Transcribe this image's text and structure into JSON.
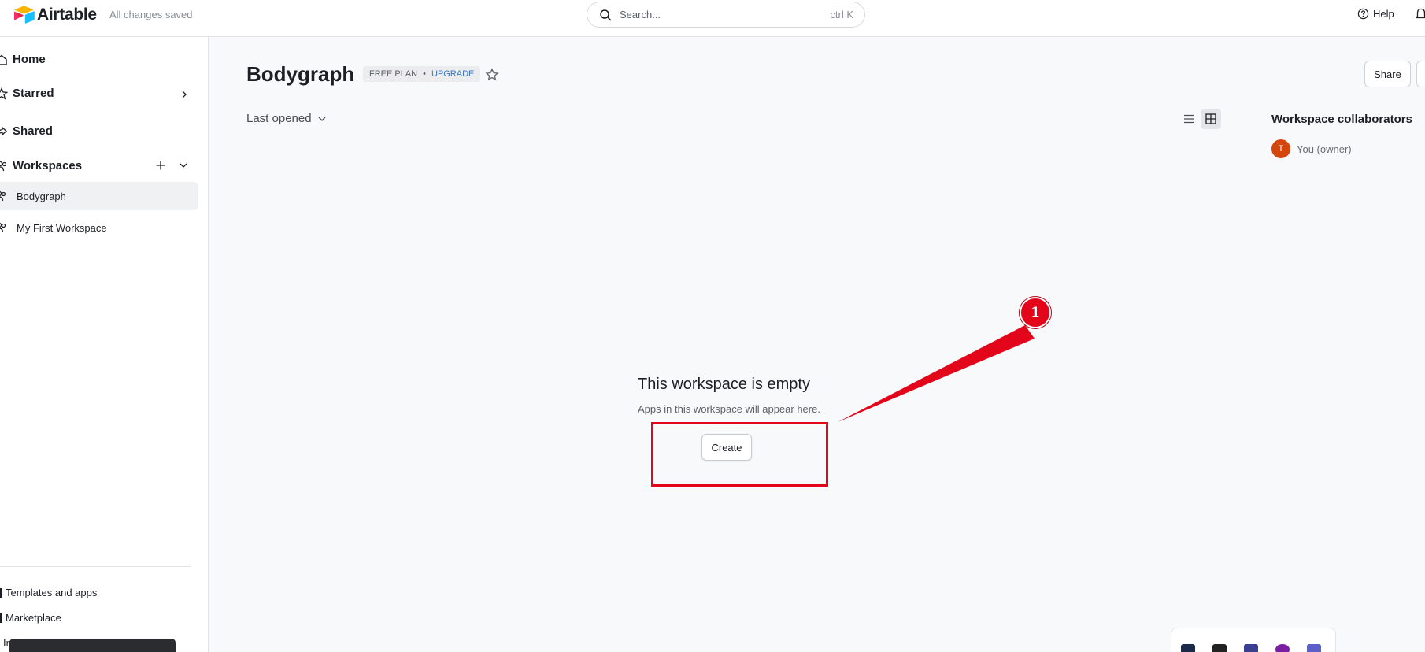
{
  "app": {
    "name": "Airtable",
    "save_status": "All changes saved"
  },
  "search": {
    "placeholder": "Search...",
    "shortcut": "ctrl K"
  },
  "header": {
    "help_label": "Help"
  },
  "sidebar": {
    "nav": [
      {
        "label": "Home"
      },
      {
        "label": "Starred"
      },
      {
        "label": "Shared"
      },
      {
        "label": "Workspaces"
      }
    ],
    "workspaces": [
      {
        "label": "Bodygraph",
        "active": true
      },
      {
        "label": "My First Workspace",
        "active": false
      }
    ],
    "bottom_links": [
      {
        "label": "Templates and apps"
      },
      {
        "label": "Marketplace"
      },
      {
        "label": "In"
      }
    ]
  },
  "workspace": {
    "title": "Bodygraph",
    "plan": "FREE PLAN",
    "separator": "•",
    "upgrade": "UPGRADE",
    "sort_label": "Last opened",
    "share_label": "Share",
    "collaborators_title": "Workspace collaborators",
    "collaborators": [
      {
        "initial": "T",
        "label": "You (owner)"
      }
    ],
    "empty_title": "This workspace is empty",
    "empty_sub": "Apps in this workspace will appear here.",
    "create_label": "Create"
  },
  "annotation": {
    "number": "1",
    "color": "#e3061a"
  },
  "colors": {
    "avatar": "#d4470c",
    "upgrade_link": "#3b79c4"
  }
}
